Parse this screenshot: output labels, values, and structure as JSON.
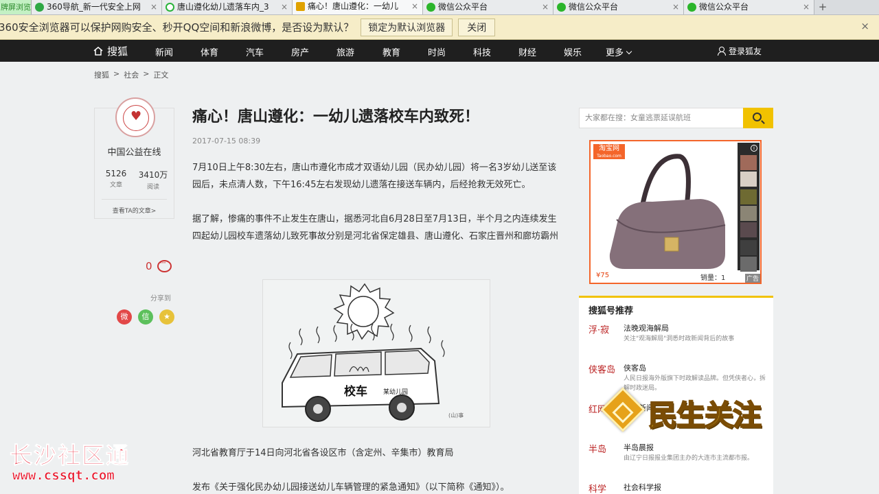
{
  "browser": {
    "first_tab": "牌屏浏览",
    "tabs": [
      {
        "label": "360导航_新一代安全上网",
        "icon_color": "#2fa845"
      },
      {
        "label": "唐山遵化幼儿遗落车内_3",
        "icon_color": "#29b33a"
      },
      {
        "label": "痛心！唐山遵化：一幼儿",
        "icon_color": "#e0a200"
      },
      {
        "label": "微信公众平台",
        "icon_color": "#2bb52b"
      },
      {
        "label": "微信公众平台",
        "icon_color": "#2bb52b"
      },
      {
        "label": "微信公众平台",
        "icon_color": "#2bb52b"
      }
    ],
    "tab_close": "×",
    "add_tab": "+",
    "infobar": {
      "message": "360安全浏览器可以保护网购安全、秒开QQ空间和新浪微博，是否设为默认？",
      "set_default": "锁定为默认浏览器",
      "close": "关闭",
      "dismiss": "×"
    }
  },
  "site_nav": {
    "logo": "搜狐",
    "items": [
      "新闻",
      "体育",
      "汽车",
      "房产",
      "旅游",
      "教育",
      "时尚",
      "科技",
      "财经",
      "娱乐",
      "更多"
    ],
    "login": "登录狐友"
  },
  "breadcrumb": [
    "搜狐",
    ">",
    "社会",
    ">",
    "正文"
  ],
  "author": {
    "name": "中国公益在线",
    "articles_count": "5126",
    "articles_label": "文章",
    "reads_count": "3410万",
    "reads_label": "阅读",
    "link": "查看TA的文章>"
  },
  "comments": {
    "count": "0"
  },
  "share": {
    "label": "分享到",
    "weibo": "微",
    "wechat": "信",
    "favorite": "★"
  },
  "article": {
    "title": "痛心！唐山遵化：一幼儿遗落校车内致死！",
    "date": "2017-07-15 08:39",
    "p1": "7月10日上午8:30左右，唐山市遵化市成才双语幼儿园（民办幼儿园）将一名3岁幼儿送至该园后，未点清人数，下午16:45左右发现幼儿遗落在接送车辆内，后经抢救无效死亡。",
    "p2": "据了解，惨痛的事件不止发生在唐山，据悉河北自6月28日至7月13日，半个月之内连续发生四起幼儿园校车遗落幼儿致死事故分别是河北省保定雄县、唐山遵化、石家庄晋州和廊坊霸州",
    "illustration": {
      "bus_label": "校车",
      "bus_sub": "某幼儿园",
      "credit": "(山)事"
    },
    "p3": "河北省教育厅于14日向河北省各设区市（含定州、辛集市）教育局",
    "p4": "发布《关于强化民办幼儿园接送幼儿车辆管理的紧急通知》（以下简称《通知》）。"
  },
  "sidebar": {
    "search_placeholder": "大家都在搜：女童逃票延误航班",
    "ad": {
      "brand": "淘宝网",
      "brand_sub": "Taobao.com",
      "price": "¥75",
      "sales": "销量：1",
      "tag": "广告"
    },
    "rec_title": "搜狐号推荐",
    "rec_items": [
      {
        "logo": "浮·寂",
        "name": "法晚观海解局",
        "desc": "关注\"观海解局\"洞悉时政新闻背后的故事"
      },
      {
        "logo": "侠客岛",
        "name": "侠客岛",
        "desc": "人民日报海外版旗下时政解读品牌。但凭侠者心，拆解时政迷局。"
      },
      {
        "logo": "红网",
        "name": "红网新闻",
        "desc": ""
      },
      {
        "logo": "半岛",
        "name": "半岛晨报",
        "desc": "由辽宁日报报业集团主办的大连市主流都市报。"
      },
      {
        "logo": "科学",
        "name": "社会科学报",
        "desc": ""
      }
    ]
  },
  "overlay": {
    "logo_text": "民生关注",
    "watermark_cn": "长沙社区通",
    "watermark_url": "www.cssqt.com"
  }
}
